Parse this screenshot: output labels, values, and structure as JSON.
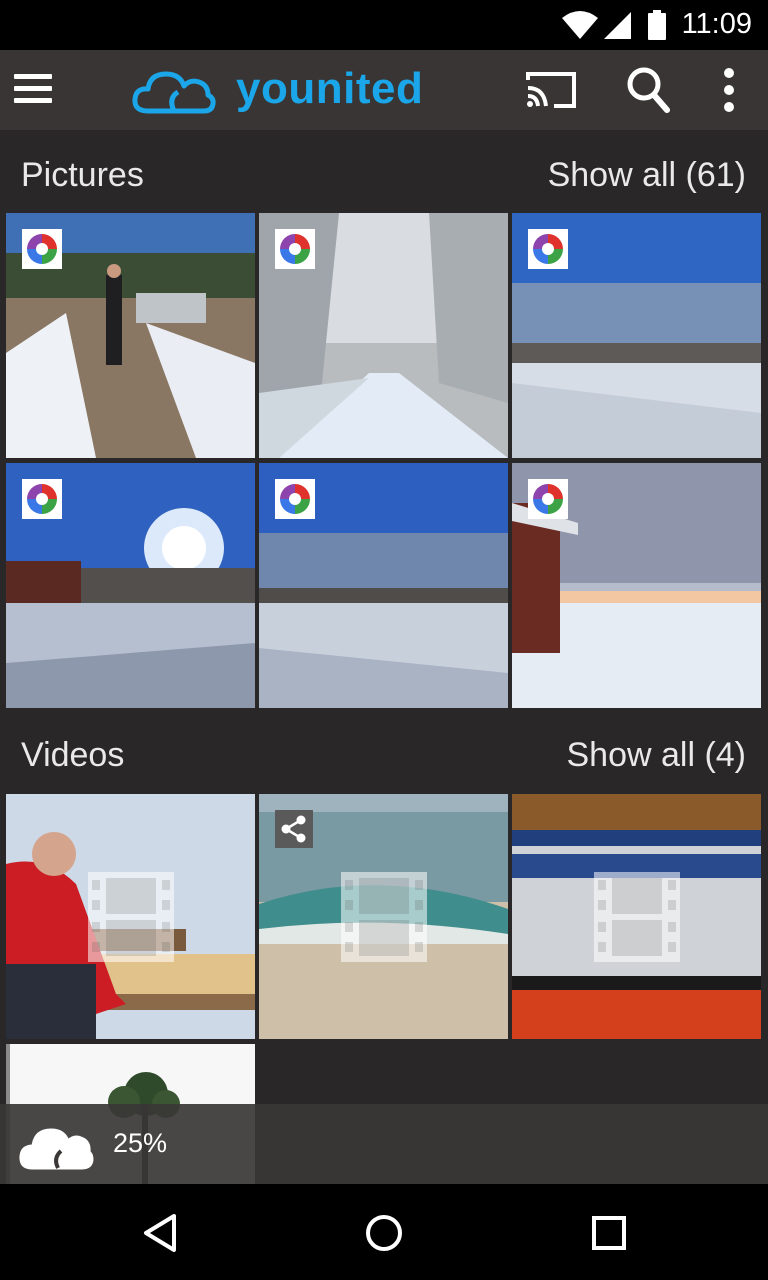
{
  "status_bar": {
    "time": "11:09"
  },
  "app_bar": {
    "brand": "younited",
    "brand_color": "#1aa6e8",
    "icons": [
      "menu-icon",
      "cloud-logo-icon",
      "cast-icon",
      "search-icon",
      "more-vert-icon"
    ]
  },
  "pictures": {
    "title": "Pictures",
    "show_all": "Show all (61)",
    "items": [
      {
        "scene": "skier on snowy path",
        "badge": "picasa-icon"
      },
      {
        "scene": "frosty forest road",
        "badge": "picasa-icon"
      },
      {
        "scene": "snowy field blue sky",
        "badge": "picasa-icon"
      },
      {
        "scene": "sun over snowy yard",
        "badge": "picasa-icon"
      },
      {
        "scene": "snowy meadow with trees",
        "badge": "picasa-icon"
      },
      {
        "scene": "sunset beside red barn",
        "badge": "picasa-icon"
      }
    ]
  },
  "videos": {
    "title": "Videos",
    "show_all": "Show all (4)",
    "items": [
      {
        "scene": "woman in red jacket on bench",
        "badge": "",
        "overlay": "film-icon"
      },
      {
        "scene": "beach waves",
        "badge": "share-icon",
        "overlay": "film-icon"
      },
      {
        "scene": "red boat closeup",
        "badge": "",
        "overlay": "film-icon"
      },
      {
        "scene": "tree against white sky",
        "badge": "",
        "overlay": ""
      }
    ]
  },
  "upload": {
    "progress_text": "25%",
    "progress": 0.25,
    "icon": "cloud-icon"
  },
  "nav": {
    "icons": [
      "back-icon",
      "home-icon",
      "recents-icon"
    ]
  }
}
